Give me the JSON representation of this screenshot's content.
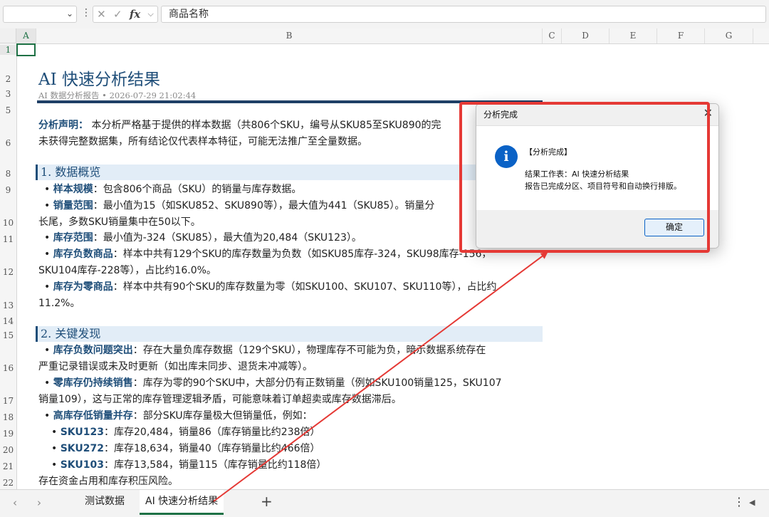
{
  "formula_bar": {
    "name_box": "",
    "cancel_glyph": "✕",
    "confirm_glyph": "✓",
    "fx_label": "fx",
    "fx_chevron": "⌵",
    "content": "商品名称"
  },
  "columns": [
    "A",
    "B",
    "C",
    "D",
    "E",
    "F",
    "G"
  ],
  "rows": [
    "1",
    "2",
    "3",
    "5",
    "6",
    "8",
    "9",
    "10",
    "11",
    "12",
    "13",
    "14",
    "15",
    "16",
    "17",
    "18",
    "19",
    "20",
    "21",
    "22"
  ],
  "report": {
    "title": "AI 快速分析结果",
    "subtitle": "AI 数据分析报告  •  2026-07-29 21:02:44",
    "disclaimer_label": "分析声明：",
    "disclaimer_text_1": " 本分析严格基于提供的样本数据（共806个SKU，编号从SKU85至SKU890的完",
    "disclaimer_text_2": "未获得完整数据集，所有结论仅代表样本特征，可能无法推广至全量数据。",
    "section1_title": "1.  数据概览",
    "s1_item1_label": "样本规模",
    "s1_item1_text": "：包含806个商品（SKU）的销量与库存数据。",
    "s1_item2_label": "销量范围",
    "s1_item2_text": "：最小值为15（如SKU852、SKU890等），最大值为441（SKU85）。销量分",
    "s1_item2_cont": "长尾，多数SKU销量集中在50以下。",
    "s1_item3_label": "库存范围",
    "s1_item3_text": "：最小值为-324（SKU85），最大值为20,484（SKU123）。",
    "s1_item4_label": "库存负数商品",
    "s1_item4_text": "：样本中共有129个SKU的库存数量为负数（如SKU85库存-324，SKU98库存-156，",
    "s1_item4_cont": "SKU104库存-228等），占比约16.0%。",
    "s1_item5_label": "库存为零商品",
    "s1_item5_text": "：样本中共有90个SKU的库存数量为零（如SKU100、SKU107、SKU110等），占比约",
    "s1_item5_cont": "11.2%。",
    "section2_title": "2.  关键发现",
    "s2_item1_label": "库存负数问题突出",
    "s2_item1_text": "：存在大量负库存数据（129个SKU），物理库存不可能为负，暗示数据系统存在",
    "s2_item1_cont": "严重记录错误或未及时更新（如出库未同步、退货未冲减等）。",
    "s2_item2_label": "零库存仍持续销售",
    "s2_item2_text": "：库存为零的90个SKU中，大部分仍有正数销量（例如SKU100销量125，SKU107",
    "s2_item2_cont": "销量109），这与正常的库存管理逻辑矛盾，可能意味着订单超卖或库存数据滞后。",
    "s2_item3_label": "高库存低销量并存",
    "s2_item3_text": "：部分SKU库存量极大但销量低，例如：",
    "sub1_label": "SKU123",
    "sub1_text": "：库存20,484，销量86（库存销量比约238倍）",
    "sub2_label": "SKU272",
    "sub2_text": "：库存18,634，销量40（库存销量比约466倍）",
    "sub3_label": "SKU103",
    "sub3_text": "：库存13,584，销量115（库存销量比约118倍）",
    "closing_text": "存在资金占用和库存积压风险。"
  },
  "sheet_tabs": {
    "prev_glyph": "‹",
    "next_glyph": "›",
    "tab1": "测试数据",
    "tab2": "AI 快速分析结果",
    "add_glyph": "+",
    "more_glyph": "⋮",
    "scroll_glyph": "◀"
  },
  "dialog": {
    "title": "分析完成",
    "close_glyph": "✕",
    "icon_glyph": "i",
    "heading": "【分析完成】",
    "line1": "结果工作表：AI 快速分析结果",
    "line2": "报告已完成分区、项目符号和自动换行排版。",
    "ok_label": "确定"
  },
  "colors": {
    "accent_blue": "#1f4e79",
    "excel_green": "#1e7145",
    "annotation_red": "#e53935",
    "info_blue": "#0a62c6"
  },
  "icons": [
    "chevron-down-icon",
    "more-vertical-icon",
    "cancel-icon",
    "confirm-icon",
    "fx-icon",
    "info-icon",
    "close-icon",
    "plus-icon"
  ]
}
